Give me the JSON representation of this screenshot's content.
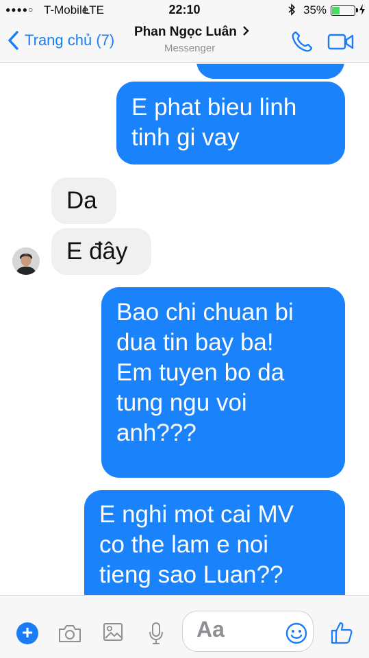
{
  "status_bar": {
    "signal": "●●●●○",
    "carrier": "T-Mobile",
    "network": "LTE",
    "time": "22:10",
    "battery_percent": "35%",
    "battery_level": 0.35
  },
  "header": {
    "back_label": "Trang chủ (7)",
    "contact_name": "Phan Ngọc Luân",
    "subtitle": "Messenger",
    "accent_color": "#1a7cf6"
  },
  "messages": [
    {
      "direction": "outgoing",
      "lines": [
        "E phat bieu linh",
        "tinh gi vay"
      ]
    },
    {
      "direction": "incoming",
      "lines": [
        "Da"
      ]
    },
    {
      "direction": "incoming",
      "lines": [
        "E đây"
      ]
    },
    {
      "direction": "outgoing",
      "lines": [
        "Bao chi chuan bi",
        "dua tin bay ba!",
        "Em tuyen bo da",
        "tung ngu voi",
        "anh???"
      ]
    },
    {
      "direction": "outgoing",
      "lines": [
        "E nghi mot cai MV",
        "co the lam e noi",
        "tieng sao Luan??"
      ]
    }
  ],
  "composer": {
    "placeholder": "Aa",
    "icons": [
      "plus-icon",
      "camera-icon",
      "photo-icon",
      "microphone-icon",
      "smiley-icon",
      "thumbs-up-icon"
    ]
  }
}
